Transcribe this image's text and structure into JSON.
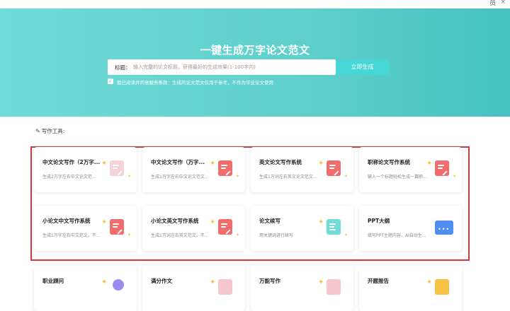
{
  "window": {
    "user_label": "员",
    "close_label": "×"
  },
  "hero": {
    "title": "一键生成万字论文范文",
    "search": {
      "label": "标题：",
      "placeholder": "输入完整的论文标题，获得最好的生成效果(1-100字内)",
      "button": "立即生成"
    },
    "agreement": {
      "checked": true,
      "text": "我已阅读并同意服务条款：生成的论文范文仅用于参考，不作为毕业论文使用"
    }
  },
  "tools_label": "写作工具:",
  "colors": {
    "accent": "#47d6d6",
    "icon_red": "#f16c6c",
    "icon_pink": "#f4c7cf",
    "icon_teal": "#6fdcd7",
    "icon_blue": "#4f8ff2",
    "highlight": "#d9363e"
  },
  "cards": [
    {
      "title": "中文论文写作（2万字...",
      "desc": "生成2万字左右中文论文范...",
      "icon": "document-pink-icon"
    },
    {
      "title": "中文论文写作（万字...",
      "desc": "生成1万字左右中文论文范文...",
      "icon": "document-red-icon"
    },
    {
      "title": "英文论文写作系统",
      "desc": "生成1万词左右英文论文范文...",
      "icon": "document-red-icon"
    },
    {
      "title": "职称论文写作系统",
      "desc": "输入一个标题轻松生成一篇职...",
      "icon": "document-red-icon"
    },
    {
      "title": "小论文中文写作系统",
      "desc": "生成1万字左右中文范文。不...",
      "icon": "document-red-icon"
    },
    {
      "title": "小论文英文写作系统",
      "desc": "生成1万词左右英文范文。不...",
      "icon": "document-red-icon"
    },
    {
      "title": "论文续写",
      "desc": "用关键词进行续写",
      "icon": "document-teal-icon"
    },
    {
      "title": "PPT大纲",
      "desc": "填写PPT主题内容，AI自动生...",
      "icon": "presentation-blue-icon"
    },
    {
      "title": "职业顾问",
      "desc": "",
      "icon": "person-purple-icon"
    },
    {
      "title": "满分作文",
      "desc": "",
      "icon": "document-pink-icon"
    },
    {
      "title": "万能写作",
      "desc": "",
      "icon": "document-pink-icon"
    },
    {
      "title": "开题报告",
      "desc": "",
      "icon": "document-yellow-icon"
    }
  ]
}
